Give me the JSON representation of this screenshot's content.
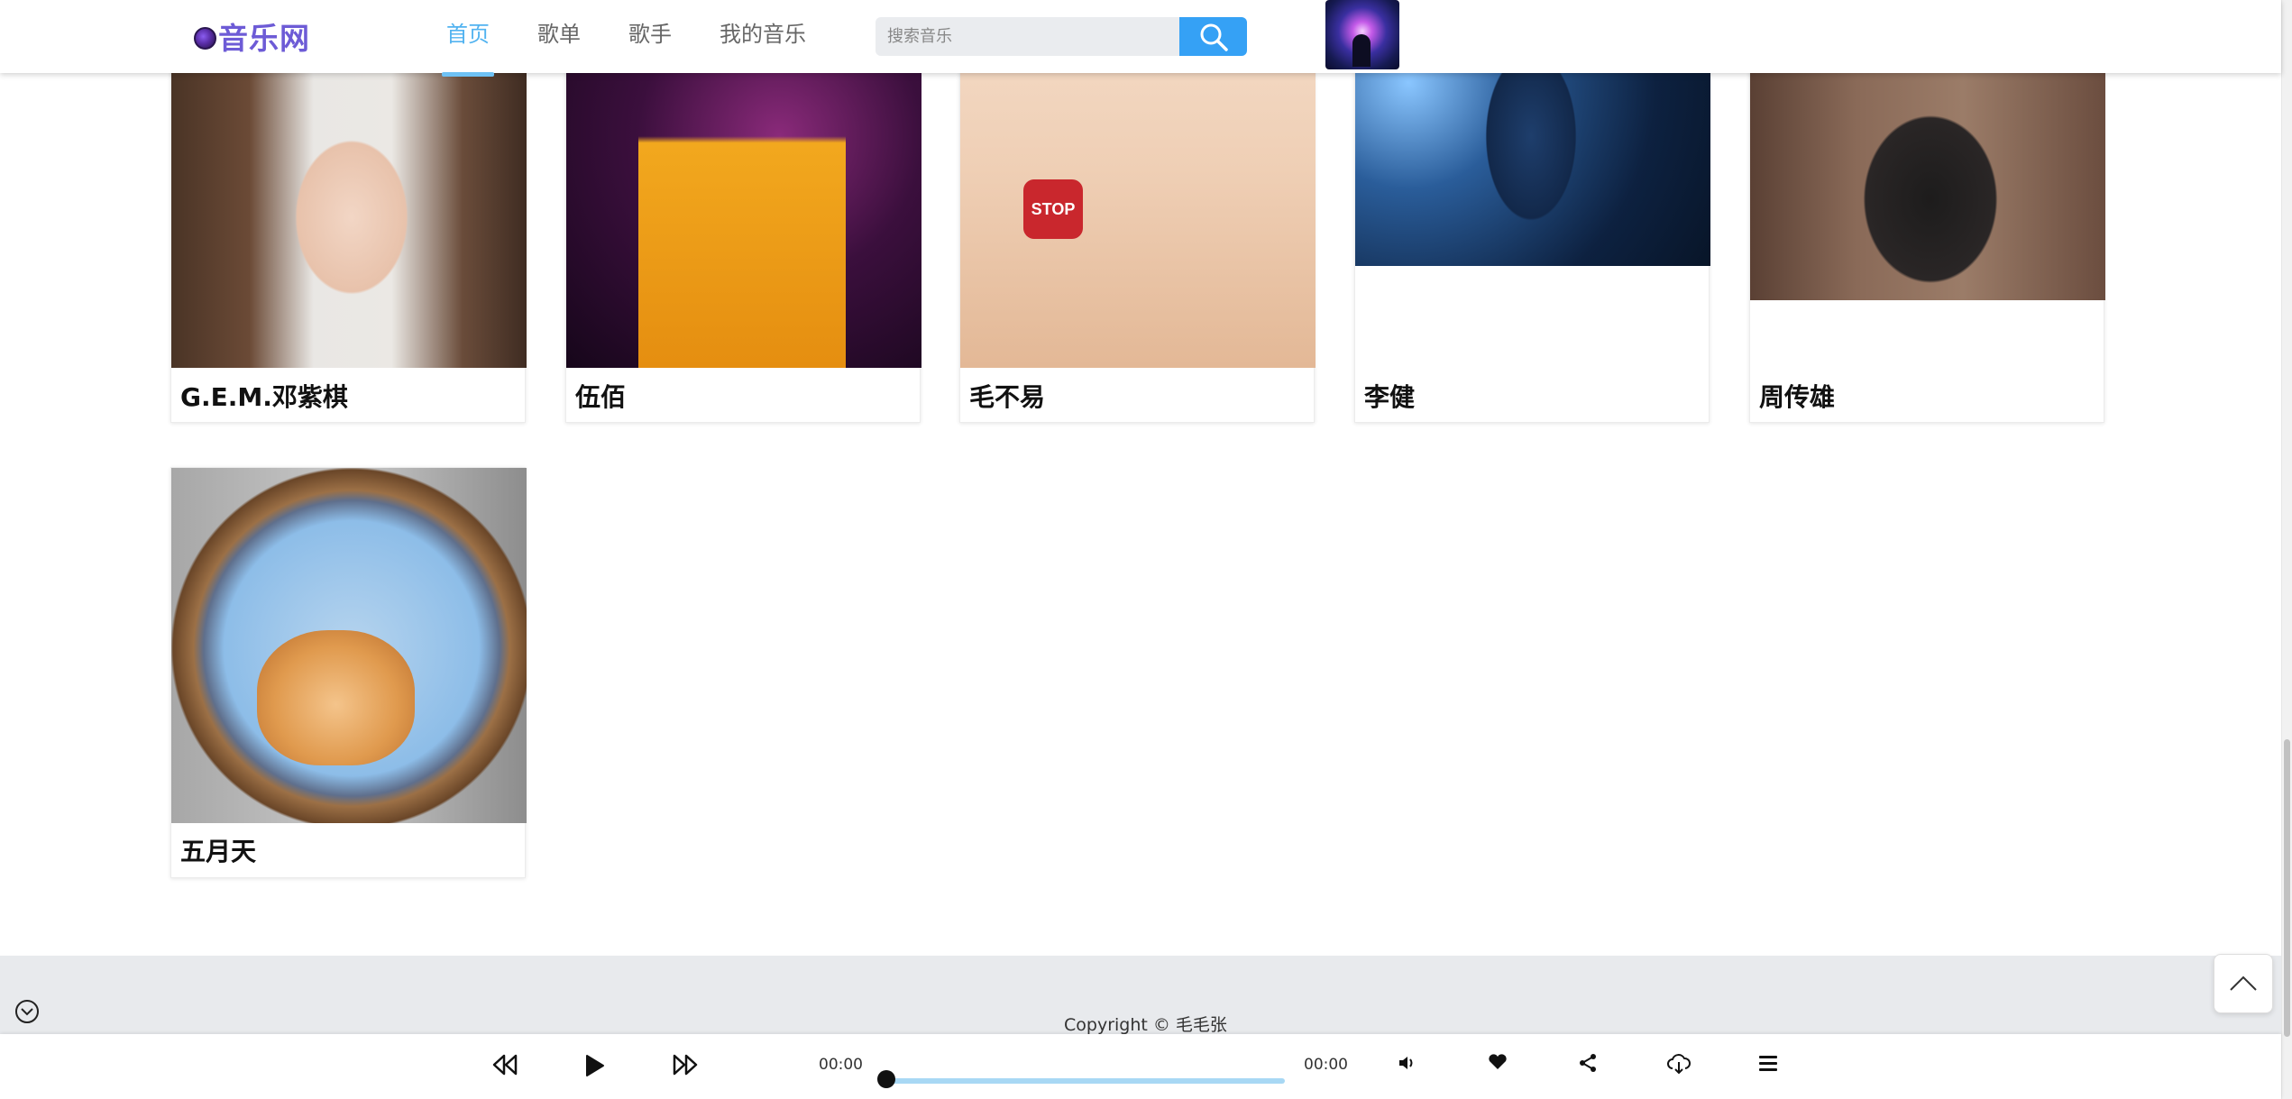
{
  "header": {
    "logo_text": "音乐网",
    "nav": [
      {
        "label": "首页",
        "active": true
      },
      {
        "label": "歌单",
        "active": false
      },
      {
        "label": "歌手",
        "active": false
      },
      {
        "label": "我的音乐",
        "active": false
      }
    ],
    "search": {
      "placeholder": "搜索音乐"
    }
  },
  "singers": [
    {
      "name": "G.E.M.邓紫棋"
    },
    {
      "name": "伍佰"
    },
    {
      "name": "毛不易"
    },
    {
      "name": "李健"
    },
    {
      "name": "周传雄"
    },
    {
      "name": "五月天"
    }
  ],
  "stop_sign_text": "STOP",
  "footer": {
    "copyright": "Copyright © 毛毛张"
  },
  "player": {
    "current_time": "00:00",
    "total_time": "00:00",
    "progress": 0
  },
  "colors": {
    "accent": "#35a1f5",
    "nav_active": "#52b3f0",
    "logo": "#6d5bd6",
    "progress_track": "#a8d8f4",
    "footer_bg": "#e8eaed"
  }
}
